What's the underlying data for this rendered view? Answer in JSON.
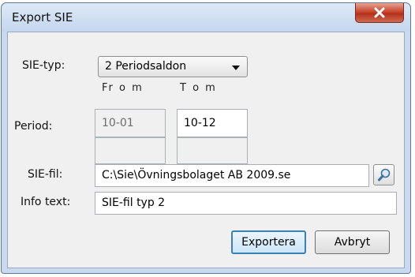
{
  "window": {
    "title": "Export SIE"
  },
  "form": {
    "sie_typ_label": "SIE-typ:",
    "sie_typ_value": "2 Periodsaldon",
    "from_label": "Fr o m",
    "tom_label": "T o m",
    "period_label": "Period:",
    "period_from": "10-01",
    "period_tom": "10-12",
    "sie_fil_label": "SIE-fil:",
    "sie_fil_value": "C:\\Sie\\Övningsbolaget AB 2009.se",
    "info_text_label": "Info text:",
    "info_text_value": "SIE-fil typ 2"
  },
  "buttons": {
    "export": "Exportera",
    "cancel": "Avbryt"
  },
  "icons": {
    "close": "close-icon",
    "dropdown": "chevron-down-icon",
    "browse": "magnifier-icon"
  },
  "colors": {
    "close_button": "#c9472f",
    "window_frame": "#c9daf0",
    "default_button_border": "#3c7fb1"
  }
}
